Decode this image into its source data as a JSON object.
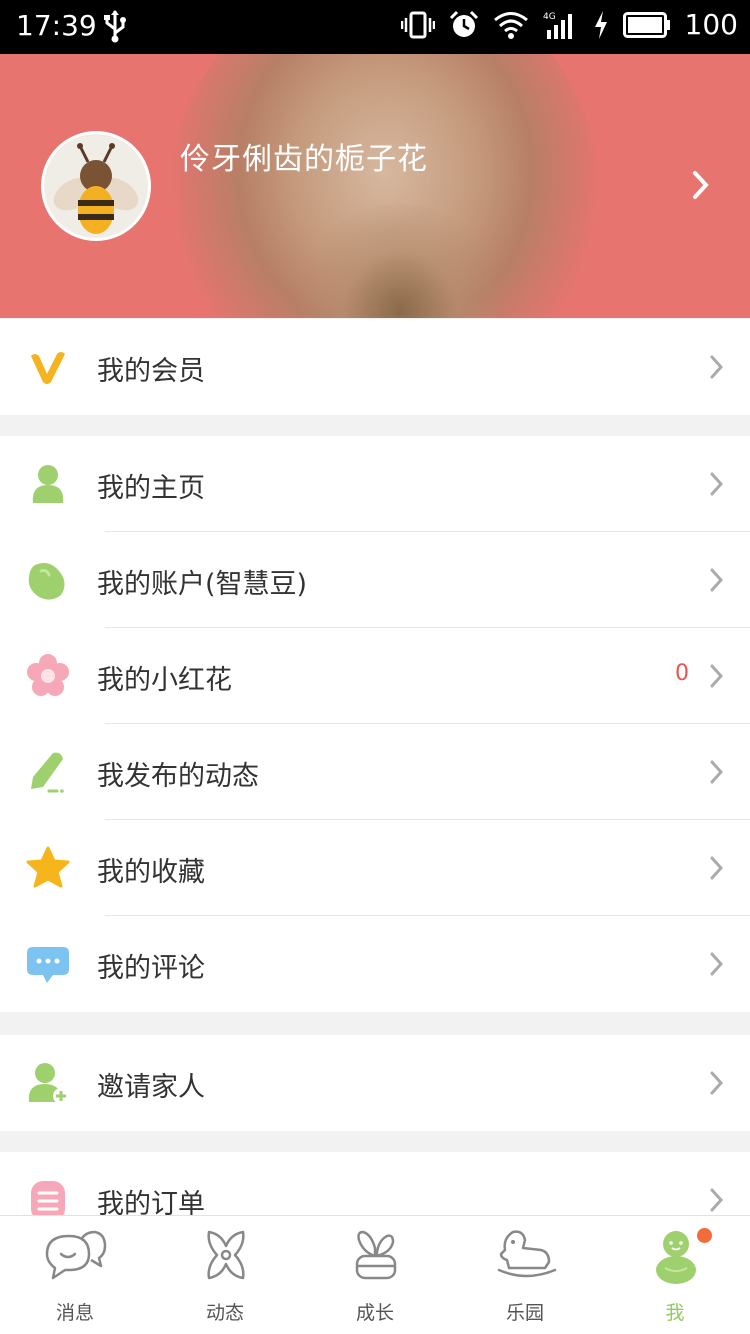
{
  "status_bar": {
    "time": "17:39",
    "battery": "100",
    "icons": [
      "usb-icon",
      "vibrate-icon",
      "alarm-icon",
      "wifi-icon",
      "signal-4g-icon",
      "charging-icon",
      "battery-icon"
    ]
  },
  "profile": {
    "username": "伶牙俐齿的栀子花",
    "avatar": "bee-avatar"
  },
  "colors": {
    "header_bg": "#e87470",
    "accent_green": "#8fcd5e",
    "count_red": "#e8544e"
  },
  "menu": {
    "membership": {
      "label": "我的会员",
      "icon": "vip-v-icon"
    },
    "homepage": {
      "label": "我的主页",
      "icon": "person-icon"
    },
    "account": {
      "label": "我的账户(智慧豆)",
      "icon": "bean-icon"
    },
    "flowers": {
      "label": "我的小红花",
      "icon": "flower-icon",
      "count": "0"
    },
    "posts": {
      "label": "我发布的动态",
      "icon": "pencil-icon"
    },
    "favorites": {
      "label": "我的收藏",
      "icon": "star-icon"
    },
    "comments": {
      "label": "我的评论",
      "icon": "comment-bubble-icon"
    },
    "invite": {
      "label": "邀请家人",
      "icon": "add-person-icon"
    },
    "orders": {
      "label": "我的订单",
      "icon": "order-list-icon"
    }
  },
  "tabs": [
    {
      "label": "消息",
      "icon": "chat-bubbles-icon"
    },
    {
      "label": "动态",
      "icon": "pinwheel-icon"
    },
    {
      "label": "成长",
      "icon": "plant-pot-icon"
    },
    {
      "label": "乐园",
      "icon": "rocking-horse-icon"
    },
    {
      "label": "我",
      "icon": "me-gourd-icon",
      "active": true
    }
  ]
}
